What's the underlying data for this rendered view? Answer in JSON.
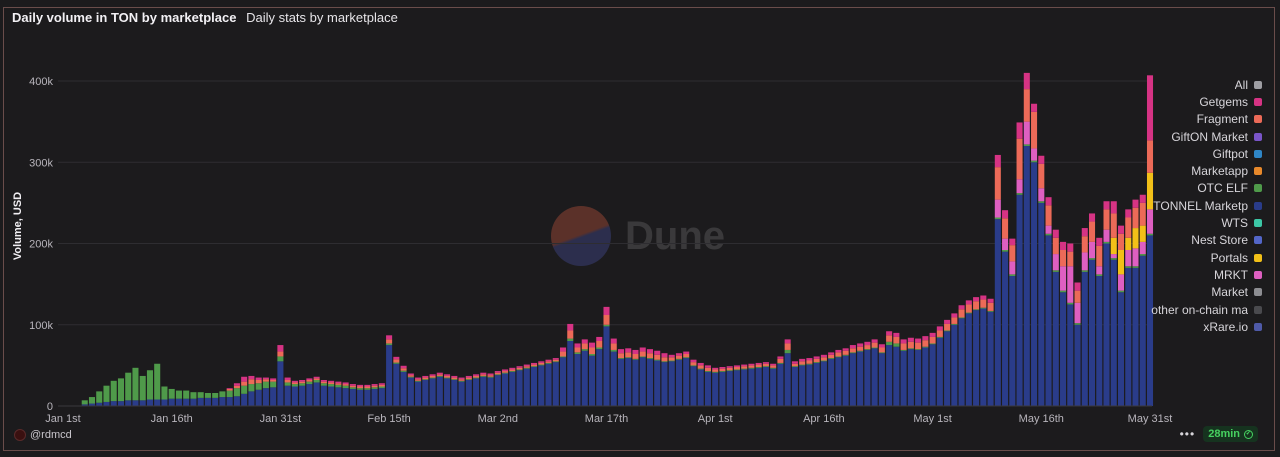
{
  "header": {
    "title": "Daily volume in TON by marketplace",
    "subtitle": "Daily stats by marketplace"
  },
  "watermark": "Dune",
  "footer": {
    "user": "@rdmcd",
    "refresh": "28min",
    "more": "•••"
  },
  "chart_data": {
    "type": "bar",
    "stacked": true,
    "ylabel": "Volume, USD",
    "ylim": [
      0,
      440000
    ],
    "yticks": [
      0,
      100000,
      200000,
      300000,
      400000
    ],
    "ytick_labels": [
      "0",
      "100k",
      "200k",
      "300k",
      "400k"
    ],
    "xtick_labels": [
      "Jan 1st",
      "Jan 16th",
      "Jan 31st",
      "Feb 15th",
      "Mar 2nd",
      "Mar 17th",
      "Apr 1st",
      "Apr 16th",
      "May 1st",
      "May 16th",
      "May 31st"
    ],
    "xtick_days": [
      0,
      15,
      30,
      45,
      60,
      75,
      90,
      105,
      120,
      135,
      150
    ],
    "days": 151,
    "grid": true,
    "legend_position": "right",
    "legend": [
      {
        "name": "All",
        "color": "#9e9ea3"
      },
      {
        "name": "Getgems",
        "color": "#d63384"
      },
      {
        "name": "Fragment",
        "color": "#ec6a58"
      },
      {
        "name": "GiftON Market",
        "color": "#7a55c9"
      },
      {
        "name": "Giftpot",
        "color": "#2f86c6"
      },
      {
        "name": "Marketapp",
        "color": "#e8892b"
      },
      {
        "name": "OTC ELF",
        "color": "#4f9a4a"
      },
      {
        "name": "TONNEL Marketp",
        "color": "#2a3c8a"
      },
      {
        "name": "WTS",
        "color": "#3cc7a6"
      },
      {
        "name": "Nest Store",
        "color": "#5366c8"
      },
      {
        "name": "Portals",
        "color": "#f2c018"
      },
      {
        "name": "MRKT",
        "color": "#de5fc1"
      },
      {
        "name": "Market",
        "color": "#8d8d92"
      },
      {
        "name": "other on-chain ma",
        "color": "#4a4a4e"
      },
      {
        "name": "xRare.io",
        "color": "#4f5aa8"
      }
    ],
    "series": [
      {
        "name": "TONNEL Marketp",
        "color": "#2a3c8a",
        "values": [
          0,
          0,
          0,
          2000,
          3000,
          4000,
          5000,
          6000,
          6000,
          7000,
          7000,
          7000,
          8000,
          8000,
          8000,
          9000,
          9000,
          9000,
          9000,
          10000,
          10000,
          10000,
          11000,
          11000,
          12000,
          15000,
          18000,
          20000,
          22000,
          23000,
          55000,
          25000,
          24000,
          25000,
          27000,
          29000,
          25000,
          24000,
          23000,
          22000,
          21000,
          20000,
          20000,
          21000,
          22000,
          75000,
          52000,
          42000,
          35000,
          30000,
          32000,
          34000,
          36000,
          34000,
          32000,
          30000,
          32000,
          34000,
          36000,
          35000,
          38000,
          40000,
          42000,
          44000,
          46000,
          48000,
          50000,
          52000,
          54000,
          60000,
          80000,
          64000,
          68000,
          62000,
          70000,
          98000,
          67000,
          58000,
          59000,
          57000,
          60000,
          58000,
          56000,
          54000,
          55000,
          57000,
          59000,
          49000,
          45000,
          42000,
          41000,
          42000,
          43000,
          44000,
          45000,
          46000,
          47000,
          48000,
          46000,
          52000,
          65000,
          48000,
          50000,
          51000,
          53000,
          55000,
          58000,
          60000,
          62000,
          65000,
          67000,
          69000,
          71000,
          65000,
          75000,
          73000,
          68000,
          70000,
          69000,
          72000,
          76000,
          84000,
          92000,
          100000,
          108000,
          114000,
          118000,
          120000,
          116000,
          230000,
          190000,
          160000,
          260000,
          320000,
          300000,
          250000,
          210000,
          165000,
          140000,
          125000,
          100000,
          165000,
          180000,
          160000,
          200000,
          180000,
          140000,
          170000,
          170000,
          185000,
          210000
        ]
      },
      {
        "name": "OTC ELF",
        "color": "#4f9a4a",
        "values": [
          0,
          0,
          0,
          5000,
          8000,
          14000,
          20000,
          25000,
          28000,
          34000,
          40000,
          30000,
          36000,
          44000,
          16000,
          12000,
          10000,
          10000,
          8000,
          7000,
          6000,
          6000,
          7000,
          8000,
          10000,
          10000,
          9000,
          8000,
          8000,
          7000,
          6000,
          4000,
          3000,
          3000,
          3000,
          3000,
          3000,
          3000,
          3000,
          3000,
          2000,
          2000,
          2000,
          2000,
          2000,
          2000,
          1500,
          1500,
          1000,
          1000,
          1000,
          1000,
          1000,
          1000,
          1000,
          1000,
          1000,
          1000,
          1000,
          1000,
          1000,
          1000,
          1000,
          1000,
          1000,
          1000,
          1000,
          1000,
          1000,
          1000,
          3000,
          2000,
          2000,
          2000,
          2000,
          2000,
          2000,
          1000,
          1000,
          1000,
          1000,
          1000,
          1000,
          1000,
          1000,
          1000,
          1000,
          1000,
          1000,
          1000,
          1000,
          1000,
          1000,
          1000,
          1000,
          1000,
          1000,
          1000,
          1000,
          1000,
          4000,
          1000,
          1000,
          1000,
          1000,
          1000,
          1000,
          1000,
          1000,
          1000,
          1000,
          1000,
          1000,
          1000,
          4000,
          4000,
          1000,
          1000,
          1000,
          1000,
          1000,
          1000,
          1000,
          1000,
          1000,
          1000,
          1000,
          1000,
          1000,
          2000,
          2000,
          2000,
          2000,
          2000,
          2000,
          2000,
          2000,
          2000,
          2000,
          2000,
          2000,
          2000,
          2000,
          2000,
          2000,
          2000,
          2000,
          2000,
          2000,
          2000,
          2000
        ]
      },
      {
        "name": "MRKT",
        "color": "#de5fc1",
        "values": [
          0,
          0,
          0,
          0,
          0,
          0,
          0,
          0,
          0,
          0,
          0,
          0,
          0,
          0,
          0,
          0,
          0,
          0,
          0,
          0,
          0,
          0,
          0,
          0,
          0,
          0,
          0,
          0,
          0,
          0,
          0,
          0,
          0,
          0,
          0,
          0,
          0,
          0,
          0,
          0,
          0,
          0,
          0,
          0,
          0,
          0,
          0,
          0,
          0,
          0,
          0,
          0,
          0,
          0,
          0,
          0,
          0,
          0,
          0,
          0,
          0,
          0,
          0,
          0,
          0,
          0,
          0,
          0,
          0,
          0,
          0,
          0,
          0,
          0,
          0,
          0,
          0,
          0,
          0,
          0,
          0,
          0,
          0,
          0,
          0,
          0,
          0,
          0,
          0,
          0,
          0,
          0,
          0,
          0,
          0,
          0,
          0,
          0,
          0,
          0,
          0,
          0,
          0,
          0,
          0,
          0,
          0,
          0,
          0,
          0,
          0,
          0,
          0,
          0,
          0,
          0,
          0,
          0,
          0,
          0,
          0,
          0,
          0,
          0,
          0,
          0,
          0,
          0,
          0,
          22000,
          14000,
          16000,
          17000,
          28000,
          15000,
          16000,
          10000,
          20000,
          30000,
          45000,
          25000,
          22000,
          20000,
          10000,
          15000,
          5000,
          20000,
          20000,
          22000,
          15000,
          30000
        ]
      },
      {
        "name": "Portals",
        "color": "#f2c018",
        "values": [
          0,
          0,
          0,
          0,
          0,
          0,
          0,
          0,
          0,
          0,
          0,
          0,
          0,
          0,
          0,
          0,
          0,
          0,
          0,
          0,
          0,
          0,
          0,
          0,
          0,
          0,
          0,
          0,
          0,
          0,
          0,
          0,
          0,
          0,
          0,
          0,
          0,
          0,
          0,
          0,
          0,
          0,
          0,
          0,
          0,
          0,
          0,
          0,
          0,
          0,
          0,
          0,
          0,
          0,
          0,
          0,
          0,
          0,
          0,
          0,
          0,
          0,
          0,
          0,
          0,
          0,
          0,
          0,
          0,
          0,
          0,
          0,
          0,
          0,
          0,
          0,
          0,
          0,
          0,
          0,
          0,
          0,
          0,
          0,
          0,
          0,
          0,
          0,
          0,
          0,
          0,
          0,
          0,
          0,
          0,
          0,
          0,
          0,
          0,
          0,
          0,
          0,
          0,
          0,
          0,
          0,
          0,
          0,
          0,
          0,
          0,
          0,
          0,
          0,
          0,
          0,
          0,
          0,
          0,
          0,
          0,
          0,
          0,
          0,
          0,
          0,
          0,
          0,
          0,
          0,
          0,
          0,
          0,
          0,
          0,
          0,
          0,
          0,
          0,
          0,
          0,
          0,
          0,
          0,
          0,
          20000,
          30000,
          15000,
          25000,
          20000,
          45000
        ]
      },
      {
        "name": "Fragment",
        "color": "#ec6a58",
        "values": [
          0,
          0,
          0,
          0,
          0,
          0,
          0,
          0,
          0,
          0,
          0,
          0,
          0,
          0,
          0,
          0,
          0,
          0,
          0,
          0,
          0,
          0,
          0,
          2000,
          3000,
          5000,
          6000,
          4000,
          3000,
          2000,
          6000,
          3000,
          2000,
          2000,
          2000,
          2000,
          2000,
          2000,
          2000,
          2000,
          2000,
          2000,
          2000,
          2000,
          2000,
          5000,
          4000,
          3000,
          2000,
          2000,
          2000,
          2000,
          2000,
          2000,
          2000,
          2000,
          2000,
          2000,
          2000,
          2000,
          2000,
          2000,
          2000,
          2000,
          2000,
          2000,
          2000,
          2000,
          2000,
          6000,
          10000,
          6000,
          7000,
          8000,
          8000,
          12000,
          8000,
          6000,
          6000,
          6000,
          6000,
          6000,
          6000,
          5000,
          4000,
          4000,
          4000,
          4000,
          4000,
          4000,
          3000,
          3000,
          3000,
          3000,
          3000,
          3000,
          3000,
          3000,
          3000,
          5000,
          8000,
          3000,
          4000,
          4000,
          4000,
          4000,
          4000,
          5000,
          5000,
          5000,
          5000,
          5000,
          6000,
          6000,
          8000,
          8000,
          8000,
          8000,
          8000,
          8000,
          8000,
          8000,
          8000,
          8000,
          10000,
          10000,
          10000,
          10000,
          10000,
          40000,
          25000,
          20000,
          50000,
          40000,
          45000,
          30000,
          25000,
          20000,
          20000,
          18000,
          15000,
          20000,
          25000,
          25000,
          25000,
          30000,
          20000,
          25000,
          25000,
          28000,
          40000
        ]
      },
      {
        "name": "Getgems",
        "color": "#d63384",
        "values": [
          0,
          0,
          0,
          0,
          0,
          0,
          0,
          0,
          0,
          0,
          0,
          0,
          0,
          0,
          0,
          0,
          0,
          0,
          0,
          0,
          0,
          0,
          0,
          1000,
          3000,
          6000,
          4000,
          3000,
          2000,
          2000,
          8000,
          3000,
          2000,
          2000,
          2000,
          2000,
          2000,
          2000,
          2000,
          2000,
          2000,
          2000,
          2000,
          2000,
          2000,
          5000,
          3000,
          3000,
          2000,
          2000,
          2000,
          2000,
          2000,
          2000,
          2000,
          2000,
          2000,
          2000,
          2000,
          2000,
          2000,
          2000,
          2000,
          2000,
          2000,
          2000,
          2000,
          2000,
          2000,
          5000,
          8000,
          5000,
          5000,
          6000,
          5000,
          10000,
          6000,
          5000,
          5000,
          5000,
          5000,
          5000,
          5000,
          5000,
          3000,
          3000,
          3000,
          3000,
          3000,
          3000,
          2000,
          2000,
          2000,
          2000,
          2000,
          2000,
          2000,
          2000,
          2000,
          3000,
          5000,
          3000,
          3000,
          3000,
          3000,
          3000,
          3000,
          3000,
          3000,
          4000,
          4000,
          4000,
          4000,
          4000,
          5000,
          5000,
          5000,
          5000,
          5000,
          5000,
          5000,
          5000,
          5000,
          5000,
          5000,
          5000,
          5000,
          5000,
          5000,
          15000,
          10000,
          8000,
          20000,
          20000,
          10000,
          10000,
          10000,
          10000,
          10000,
          10000,
          10000,
          10000,
          10000,
          10000,
          10000,
          15000,
          10000,
          10000,
          10000,
          10000,
          80000
        ]
      }
    ]
  }
}
